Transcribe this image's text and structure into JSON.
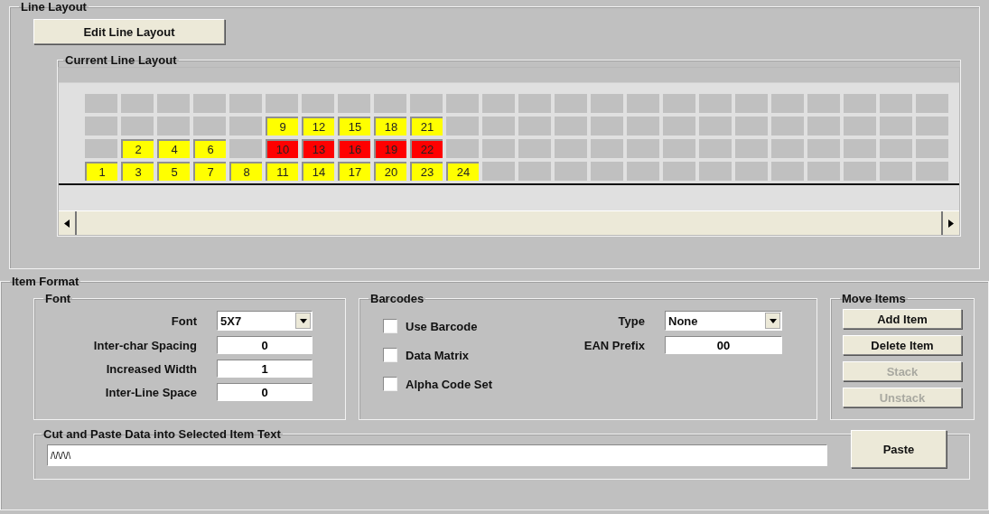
{
  "line_layout": {
    "title": "Line Layout",
    "edit_button": "Edit Line Layout",
    "current": {
      "title": "Current Line Layout",
      "columns": [
        {
          "slots": [
            {
              "kind": "empty"
            },
            {
              "kind": "empty"
            },
            {
              "kind": "empty"
            },
            {
              "kind": "item",
              "label": "1",
              "color": "#ffff00"
            }
          ]
        },
        {
          "slots": [
            {
              "kind": "empty"
            },
            {
              "kind": "empty"
            },
            {
              "kind": "item",
              "label": "2",
              "color": "#ffff00"
            },
            {
              "kind": "item",
              "label": "3",
              "color": "#ffff00"
            }
          ]
        },
        {
          "slots": [
            {
              "kind": "empty"
            },
            {
              "kind": "empty"
            },
            {
              "kind": "item",
              "label": "4",
              "color": "#ffff00"
            },
            {
              "kind": "item",
              "label": "5",
              "color": "#ffff00"
            }
          ]
        },
        {
          "slots": [
            {
              "kind": "empty"
            },
            {
              "kind": "empty"
            },
            {
              "kind": "item",
              "label": "6",
              "color": "#ffff00"
            },
            {
              "kind": "item",
              "label": "7",
              "color": "#ffff00"
            }
          ]
        },
        {
          "slots": [
            {
              "kind": "empty"
            },
            {
              "kind": "empty"
            },
            {
              "kind": "empty"
            },
            {
              "kind": "item",
              "label": "8",
              "color": "#ffff00"
            }
          ]
        },
        {
          "slots": [
            {
              "kind": "empty"
            },
            {
              "kind": "item",
              "label": "9",
              "color": "#ffff00"
            },
            {
              "kind": "item",
              "label": "10",
              "color": "#ff0000"
            },
            {
              "kind": "item",
              "label": "11",
              "color": "#ffff00"
            }
          ]
        },
        {
          "slots": [
            {
              "kind": "empty"
            },
            {
              "kind": "item",
              "label": "12",
              "color": "#ffff00"
            },
            {
              "kind": "item",
              "label": "13",
              "color": "#ff0000"
            },
            {
              "kind": "item",
              "label": "14",
              "color": "#ffff00"
            }
          ]
        },
        {
          "slots": [
            {
              "kind": "empty"
            },
            {
              "kind": "item",
              "label": "15",
              "color": "#ffff00"
            },
            {
              "kind": "item",
              "label": "16",
              "color": "#ff0000"
            },
            {
              "kind": "item",
              "label": "17",
              "color": "#ffff00"
            }
          ]
        },
        {
          "slots": [
            {
              "kind": "empty"
            },
            {
              "kind": "item",
              "label": "18",
              "color": "#ffff00"
            },
            {
              "kind": "item",
              "label": "19",
              "color": "#ff0000"
            },
            {
              "kind": "item",
              "label": "20",
              "color": "#ffff00"
            }
          ]
        },
        {
          "slots": [
            {
              "kind": "empty"
            },
            {
              "kind": "item",
              "label": "21",
              "color": "#ffff00"
            },
            {
              "kind": "item",
              "label": "22",
              "color": "#ff0000"
            },
            {
              "kind": "item",
              "label": "23",
              "color": "#ffff00"
            }
          ]
        },
        {
          "slots": [
            {
              "kind": "empty"
            },
            {
              "kind": "empty"
            },
            {
              "kind": "empty"
            },
            {
              "kind": "item",
              "label": "24",
              "color": "#ffff00"
            }
          ]
        },
        {
          "slots": [
            {
              "kind": "empty"
            },
            {
              "kind": "empty"
            },
            {
              "kind": "empty"
            },
            {
              "kind": "empty"
            }
          ]
        },
        {
          "slots": [
            {
              "kind": "empty"
            },
            {
              "kind": "empty"
            },
            {
              "kind": "empty"
            },
            {
              "kind": "empty"
            }
          ]
        },
        {
          "slots": [
            {
              "kind": "empty"
            },
            {
              "kind": "empty"
            },
            {
              "kind": "empty"
            },
            {
              "kind": "empty"
            }
          ]
        },
        {
          "slots": [
            {
              "kind": "empty"
            },
            {
              "kind": "empty"
            },
            {
              "kind": "empty"
            },
            {
              "kind": "empty"
            }
          ]
        },
        {
          "slots": [
            {
              "kind": "empty"
            },
            {
              "kind": "empty"
            },
            {
              "kind": "empty"
            },
            {
              "kind": "empty"
            }
          ]
        },
        {
          "slots": [
            {
              "kind": "empty"
            },
            {
              "kind": "empty"
            },
            {
              "kind": "empty"
            },
            {
              "kind": "empty"
            }
          ]
        },
        {
          "slots": [
            {
              "kind": "empty"
            },
            {
              "kind": "empty"
            },
            {
              "kind": "empty"
            },
            {
              "kind": "empty"
            }
          ]
        },
        {
          "slots": [
            {
              "kind": "empty"
            },
            {
              "kind": "empty"
            },
            {
              "kind": "empty"
            },
            {
              "kind": "empty"
            }
          ]
        },
        {
          "slots": [
            {
              "kind": "empty"
            },
            {
              "kind": "empty"
            },
            {
              "kind": "empty"
            },
            {
              "kind": "empty"
            }
          ]
        },
        {
          "slots": [
            {
              "kind": "empty"
            },
            {
              "kind": "empty"
            },
            {
              "kind": "empty"
            },
            {
              "kind": "empty"
            }
          ]
        },
        {
          "slots": [
            {
              "kind": "empty"
            },
            {
              "kind": "empty"
            },
            {
              "kind": "empty"
            },
            {
              "kind": "empty"
            }
          ]
        },
        {
          "slots": [
            {
              "kind": "empty"
            },
            {
              "kind": "empty"
            },
            {
              "kind": "empty"
            },
            {
              "kind": "empty"
            }
          ]
        },
        {
          "slots": [
            {
              "kind": "empty"
            },
            {
              "kind": "empty"
            },
            {
              "kind": "empty"
            },
            {
              "kind": "empty"
            }
          ]
        }
      ]
    }
  },
  "item_format": {
    "title": "Item Format",
    "font": {
      "title": "Font",
      "fields": [
        {
          "kind": "dropdown",
          "label": "Font",
          "value": "5X7"
        },
        {
          "kind": "text",
          "label": "Inter-char Spacing",
          "value": "0"
        },
        {
          "kind": "text",
          "label": "Increased Width",
          "value": "1"
        },
        {
          "kind": "text",
          "label": "Inter-Line Space",
          "value": "0"
        }
      ]
    },
    "barcodes": {
      "title": "Barcodes",
      "checkboxes": [
        {
          "label": "Use Barcode",
          "checked": false
        },
        {
          "label": "Data Matrix",
          "checked": false
        },
        {
          "label": "Alpha Code Set",
          "checked": false
        }
      ],
      "fields": [
        {
          "kind": "dropdown",
          "label": "Type",
          "value": "None"
        },
        {
          "kind": "text",
          "label": "EAN Prefix",
          "value": "00"
        }
      ]
    },
    "move_items": {
      "title": "Move Items",
      "buttons": [
        {
          "label": "Add Item",
          "disabled": false
        },
        {
          "label": "Delete Item",
          "disabled": false
        },
        {
          "label": "Stack",
          "disabled": true
        },
        {
          "label": "Unstack",
          "disabled": true
        }
      ]
    },
    "paste": {
      "title": "Cut and Paste Data into Selected Item Text",
      "value": "/\\/\\/\\/\\",
      "button": "Paste"
    }
  }
}
